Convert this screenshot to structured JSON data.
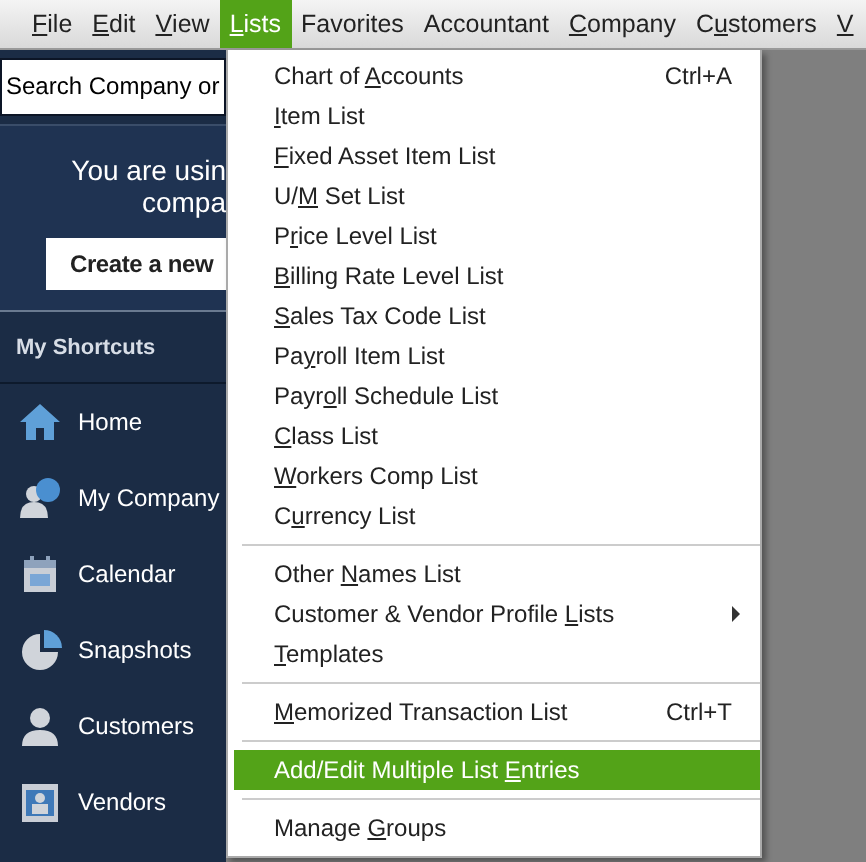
{
  "menu_bar": [
    {
      "key": "F",
      "after": "ile",
      "selected": false
    },
    {
      "key": "E",
      "after": "dit",
      "selected": false
    },
    {
      "key": "V",
      "after": "iew",
      "selected": false
    },
    {
      "key": "L",
      "after": "ists",
      "selected": true
    },
    {
      "before": "Favorites",
      "selected": false
    },
    {
      "before": "Accountant",
      "selected": false
    },
    {
      "key": "C",
      "after": "ompany",
      "selected": false
    },
    {
      "before": "C",
      "key": "u",
      "after": "stomers",
      "selected": false
    },
    {
      "key": "V",
      "selected": false
    }
  ],
  "search": {
    "placeholder": "Search Company or"
  },
  "banner": {
    "lines": [
      "You are usin",
      "compa"
    ],
    "button": "Create a new"
  },
  "shortcuts": {
    "title": "My Shortcuts",
    "items": [
      {
        "label": "Home",
        "kind": "home"
      },
      {
        "label": "My Company",
        "kind": "company"
      },
      {
        "label": "Calendar",
        "kind": "calendar"
      },
      {
        "label": "Snapshots",
        "kind": "snapshots"
      },
      {
        "label": "Customers",
        "kind": "customers"
      },
      {
        "label": "Vendors",
        "kind": "vendors"
      }
    ]
  },
  "lists_menu": [
    {
      "before": "Chart of ",
      "key": "A",
      "after": "ccounts",
      "shortcut": "Ctrl+A",
      "selected": false
    },
    {
      "key": "I",
      "after": "tem List",
      "selected": false
    },
    {
      "key": "F",
      "after": "ixed Asset Item List",
      "selected": false
    },
    {
      "before": "U/",
      "key": "M",
      "after": " Set List",
      "selected": false
    },
    {
      "before": "P",
      "key": "r",
      "after": "ice Level List",
      "selected": false
    },
    {
      "key": "B",
      "after": "illing Rate Level List",
      "selected": false
    },
    {
      "key": "S",
      "after": "ales Tax Code List",
      "selected": false
    },
    {
      "before": "Pa",
      "key": "y",
      "after": "roll Item List",
      "selected": false
    },
    {
      "before": "Payr",
      "key": "o",
      "after": "ll Schedule List",
      "selected": false
    },
    {
      "key": "C",
      "after": "lass List",
      "selected": false
    },
    {
      "key": "W",
      "after": "orkers Comp List",
      "selected": false
    },
    {
      "before": "C",
      "key": "u",
      "after": "rrency List",
      "selected": false,
      "separator_after": true
    },
    {
      "before": "Other ",
      "key": "N",
      "after": "ames List",
      "selected": false
    },
    {
      "before": "Customer & Vendor Profile ",
      "key": "L",
      "after": "ists",
      "selected": false,
      "submenu": true
    },
    {
      "key": "T",
      "after": "emplates",
      "selected": false,
      "separator_after": true
    },
    {
      "key": "M",
      "after": "emorized Transaction List",
      "shortcut": "Ctrl+T",
      "selected": false,
      "separator_after": true
    },
    {
      "before": "Add/Edit Multiple List ",
      "key": "E",
      "after": "ntries",
      "selected": true,
      "separator_after": true
    },
    {
      "before": "Manage ",
      "key": "G",
      "after": "roups",
      "selected": false
    }
  ]
}
